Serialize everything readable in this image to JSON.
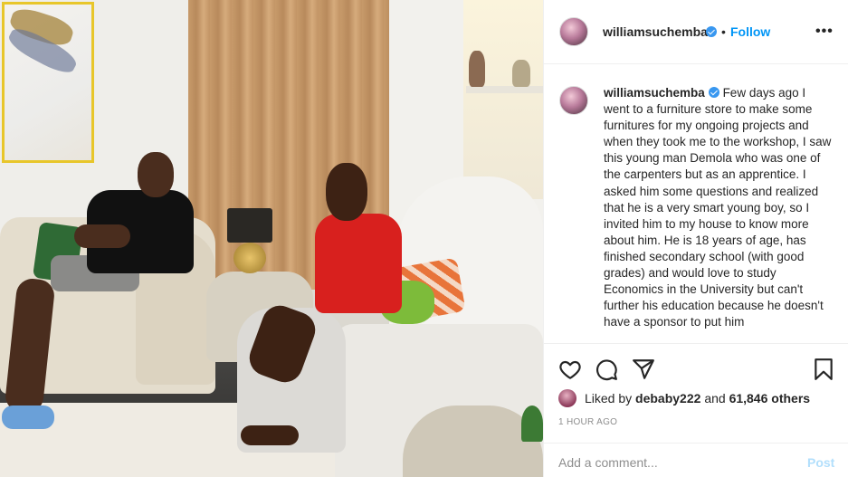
{
  "post": {
    "username": "williamsuchemba",
    "follow_label": "Follow",
    "more_label": "•••",
    "separator": "•"
  },
  "caption": {
    "username": "williamsuchemba",
    "text": "Few days ago I went to a furniture store to make some furnitures for my ongoing projects and when they took me to the workshop, I saw this young man Demola who was one of the carpenters but as an apprentice. I asked him some questions and realized that he is a very smart young boy, so I invited him to my house to know more about him. He is 18 years of age, has finished secondary school (with good grades) and would love to study Economics in the University but can't further his education because he doesn't have a sponsor to put him"
  },
  "actions": {
    "icons": [
      "heart-icon",
      "comment-icon",
      "share-icon",
      "bookmark-icon"
    ]
  },
  "likes": {
    "prefix": "Liked by",
    "user": "debaby222",
    "conjunction": "and",
    "count": "61,846 others"
  },
  "timestamp": "1 HOUR AGO",
  "comment_box": {
    "placeholder": "Add a comment...",
    "post_label": "Post"
  },
  "colors": {
    "link_blue": "#0095f6",
    "verified_blue": "#3897f0",
    "post_disabled": "#b2dffc"
  }
}
